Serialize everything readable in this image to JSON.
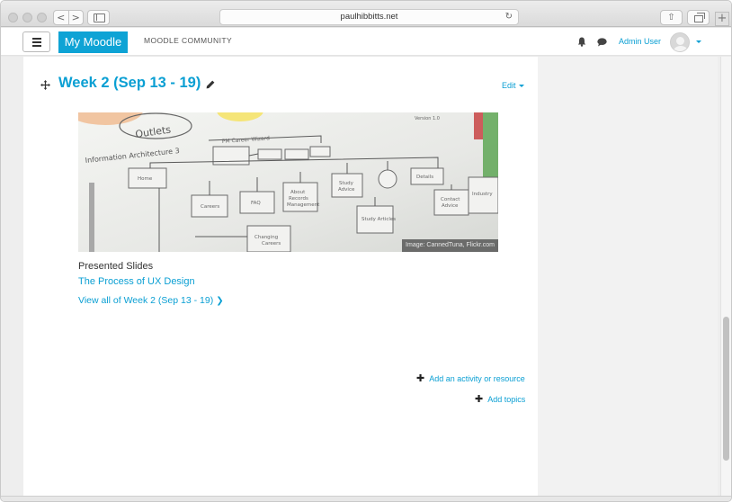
{
  "browser": {
    "url": "paulhibbitts.net",
    "back_glyph": "<",
    "forward_glyph": ">",
    "reload_glyph": "↻",
    "share_glyph": "⇧",
    "newtab_glyph": "+"
  },
  "navbar": {
    "brand": "My Moodle",
    "community": "MOODLE COMMUNITY",
    "user_name": "Admin User"
  },
  "section": {
    "title": "Week 2 (Sep 13 - 19)",
    "edit_label": "Edit",
    "image_credit": "Image: CannedTuna, Flickr.com",
    "slides_label": "Presented Slides",
    "slides_link": "The Process of UX Design",
    "view_all": "View all of Week 2 (Sep 13 - 19)",
    "view_all_chevron": "❯"
  },
  "actions": {
    "add_activity": "Add an activity or resource",
    "add_topics": "Add topics",
    "plus_glyph": "✚"
  },
  "colors": {
    "accent": "#0a9fd3",
    "brand_bg": "#0ea3d5"
  },
  "icons": [
    "bell-icon",
    "chat-icon",
    "move-icon",
    "pencil-icon",
    "plus-icon",
    "hamburger-icon",
    "chevron-right-icon"
  ]
}
